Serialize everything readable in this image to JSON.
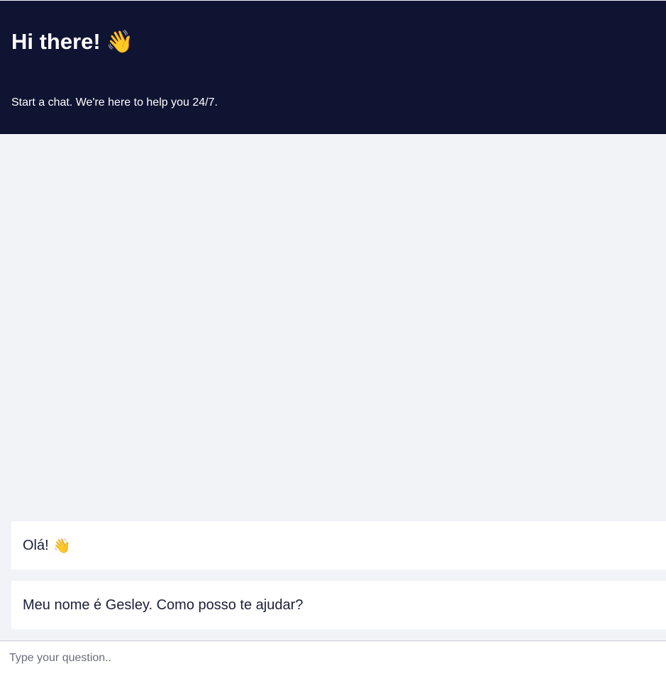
{
  "header": {
    "title": "Hi there!",
    "title_emoji": "👋",
    "subtitle": "Start a chat. We're here to help you 24/7."
  },
  "messages": [
    {
      "text": "Olá!",
      "emoji": "👋"
    },
    {
      "text": "Meu nome é Gesley. Como posso te ajudar?"
    }
  ],
  "input": {
    "placeholder": "Type your question..",
    "value": ""
  },
  "icons": {
    "wave": "waving-hand-icon"
  },
  "colors": {
    "header_bg": "#101433",
    "chat_bg": "#f2f3f7",
    "message_bg": "#ffffff",
    "text_dark": "#1c1f3a"
  }
}
